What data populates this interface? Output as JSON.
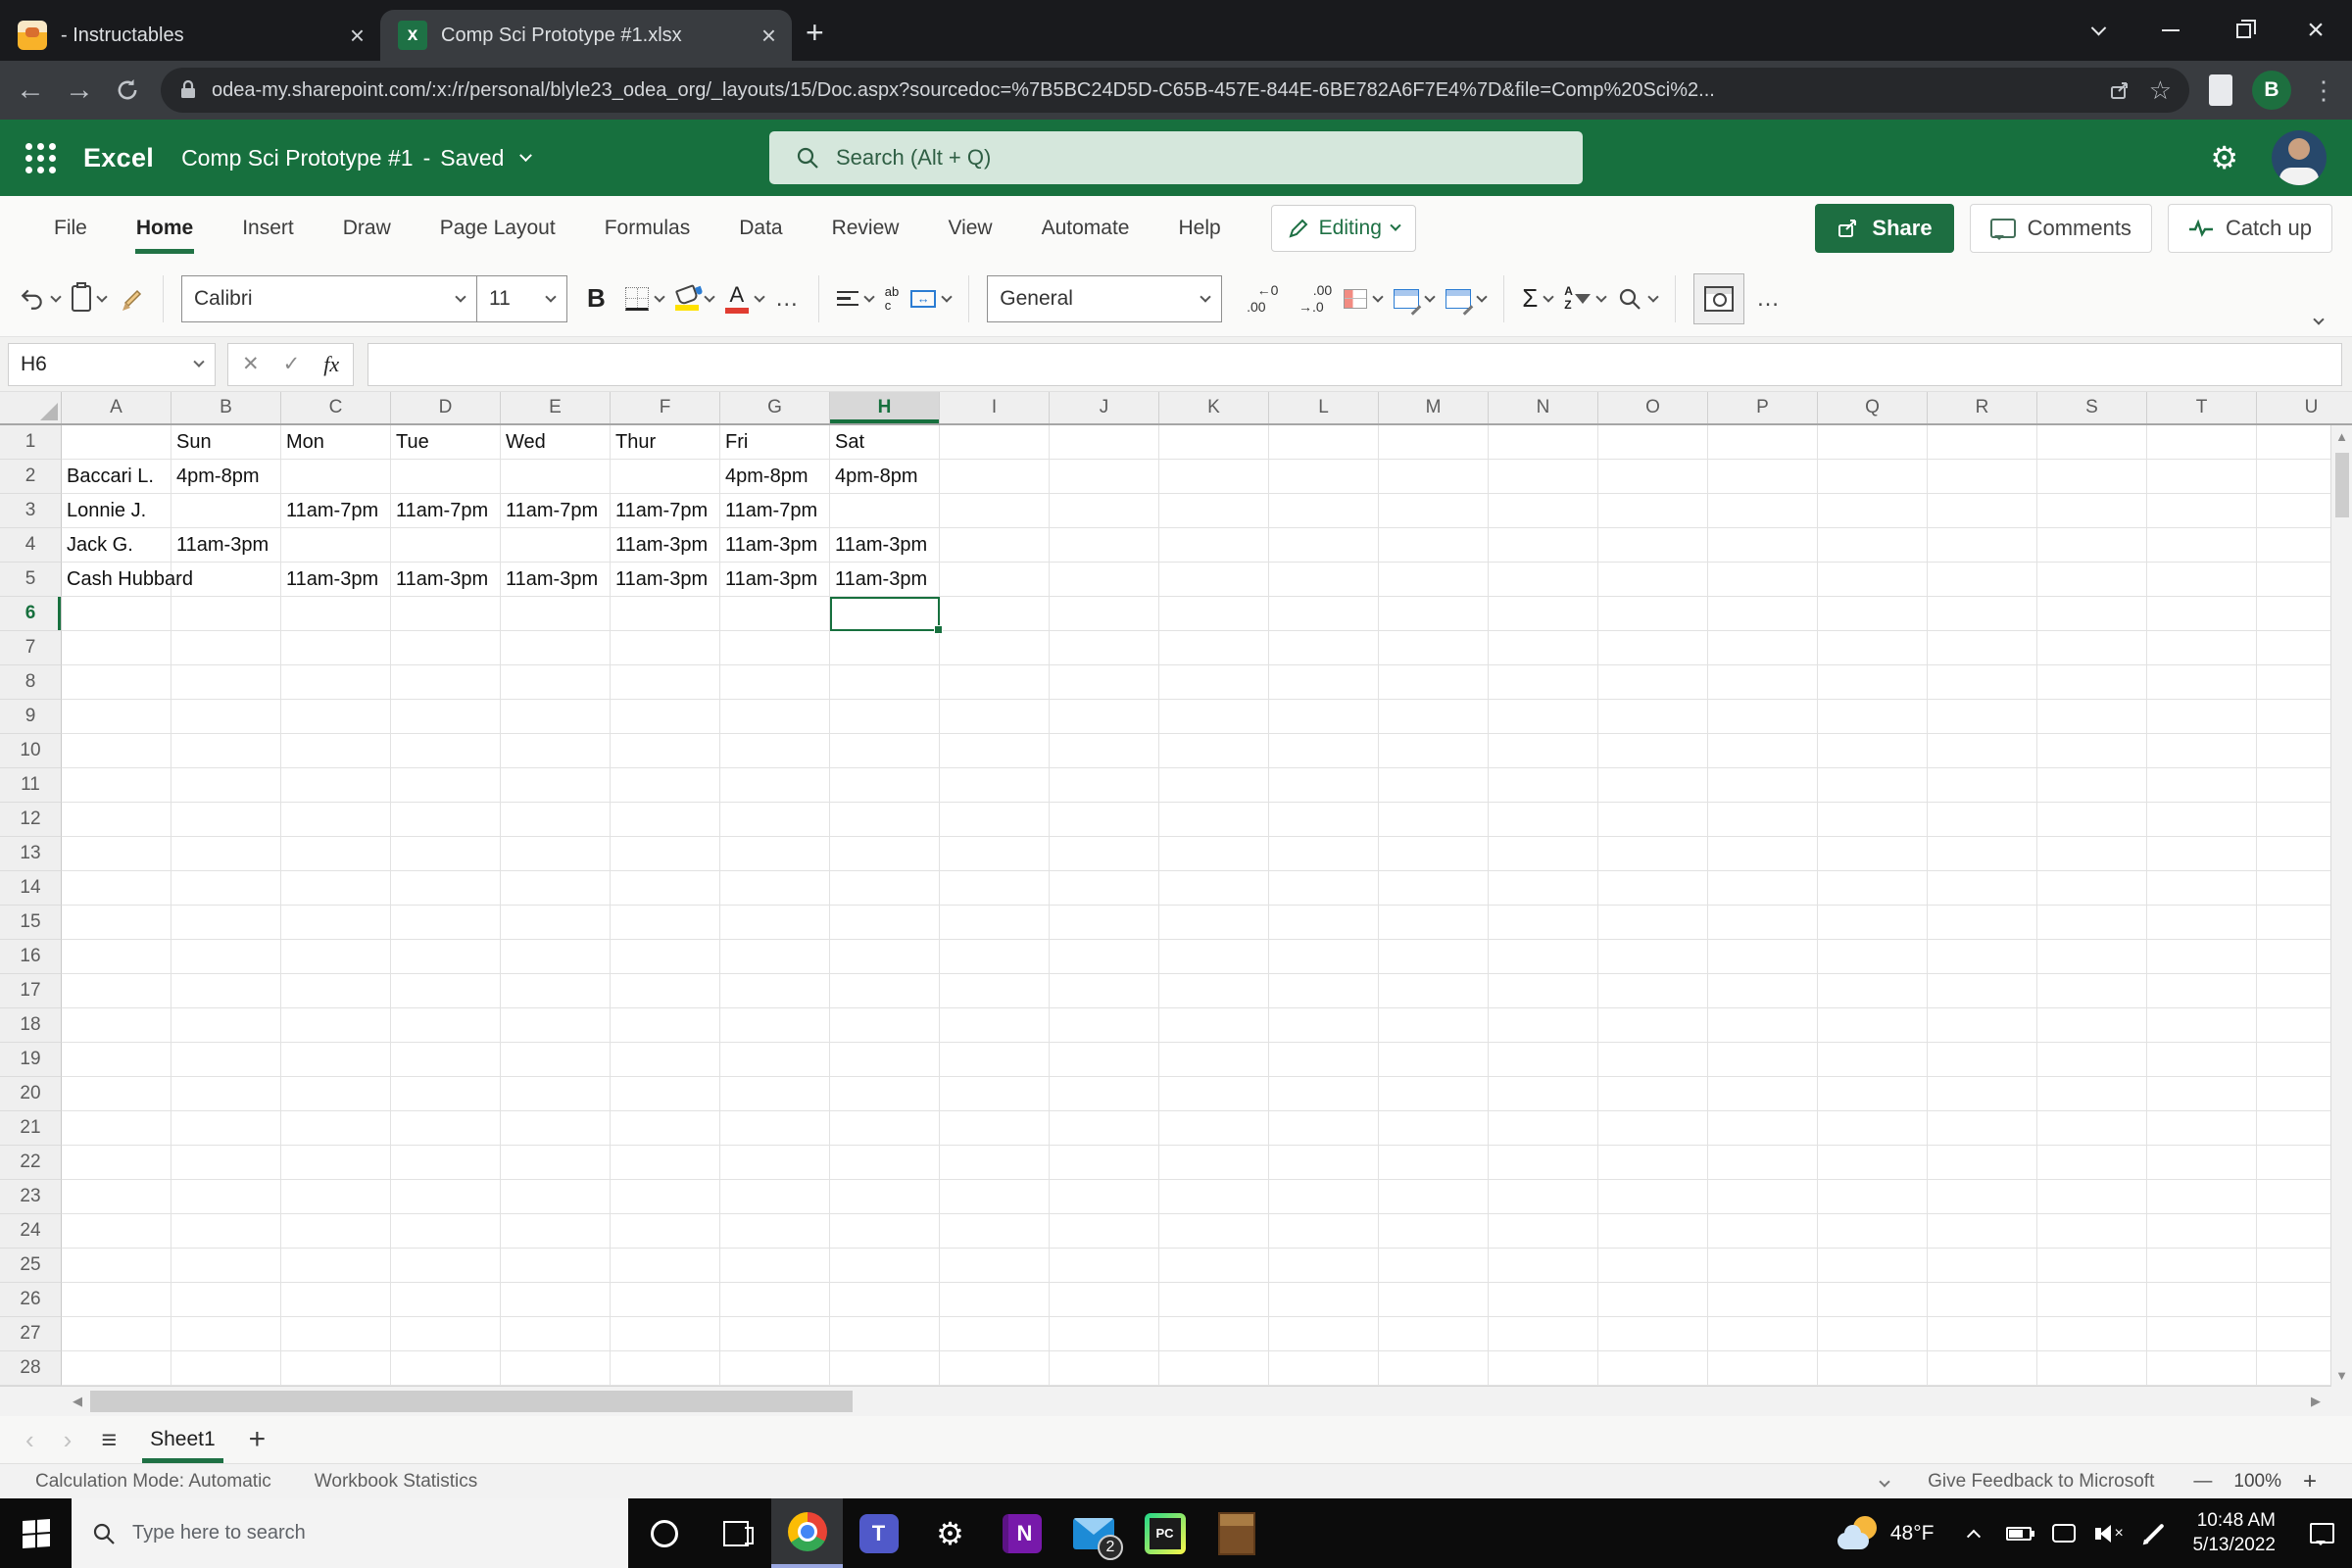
{
  "browser": {
    "tabs": [
      {
        "title": "- Instructables"
      },
      {
        "title": "Comp Sci Prototype #1.xlsx"
      }
    ],
    "url": "odea-my.sharepoint.com/:x:/r/personal/blyle23_odea_org/_layouts/15/Doc.aspx?sourcedoc=%7B5BC24D5D-C65B-457E-844E-6BE782A6F7E4%7D&file=Comp%20Sci%2...",
    "profile_initial": "B"
  },
  "header": {
    "app_name": "Excel",
    "doc_title": "Comp Sci Prototype #1",
    "separator": "-",
    "save_status": "Saved",
    "search_placeholder": "Search (Alt + Q)"
  },
  "ribbon": {
    "tabs": [
      "File",
      "Home",
      "Insert",
      "Draw",
      "Page Layout",
      "Formulas",
      "Data",
      "Review",
      "View",
      "Automate",
      "Help"
    ],
    "active_tab": "Home",
    "editing_label": "Editing",
    "share_label": "Share",
    "comments_label": "Comments",
    "catchup_label": "Catch up"
  },
  "toolbar": {
    "font_name": "Calibri",
    "font_size": "11",
    "number_format": "General",
    "glyphs": {
      "bold": "B",
      "font_color": "A",
      "wrap_top": "ab",
      "wrap_bottom": "c",
      "merge_arrows": "↔",
      "sum": "Σ",
      "sort_top": "A",
      "sort_bottom": "Z",
      "more": "…",
      "decrease_top": "←0",
      "decrease_bottom": ".00",
      "increase_top": ".00",
      "increase_bottom": "→.0"
    }
  },
  "formula_bar": {
    "name_box": "H6",
    "cancel_glyph": "✕",
    "enter_glyph": "✓",
    "fx_glyph": "fx",
    "formula": ""
  },
  "grid": {
    "columns": [
      "A",
      "B",
      "C",
      "D",
      "E",
      "F",
      "G",
      "H",
      "I",
      "J",
      "K",
      "L",
      "M",
      "N",
      "O",
      "P",
      "Q",
      "R",
      "S",
      "T",
      "U"
    ],
    "rows_visible": 28,
    "selected_cell": {
      "col": "H",
      "row": 6
    },
    "cell_data": {
      "1": {
        "B": "Sun",
        "C": "Mon",
        "D": "Tue",
        "E": "Wed",
        "F": "Thur",
        "G": "Fri",
        "H": "Sat"
      },
      "2": {
        "A": "Baccari L.",
        "B": "4pm-8pm",
        "G": "4pm-8pm",
        "H": "4pm-8pm"
      },
      "3": {
        "A": "Lonnie J.",
        "C": "11am-7pm",
        "D": "11am-7pm",
        "E": "11am-7pm",
        "F": "11am-7pm",
        "G": "11am-7pm"
      },
      "4": {
        "A": "Jack G.",
        "B": "11am-3pm",
        "F": "11am-3pm",
        "G": "11am-3pm",
        "H": "11am-3pm"
      },
      "5": {
        "A": "Cash Hubbard",
        "C": "11am-3pm",
        "D": "11am-3pm",
        "E": "11am-3pm",
        "F": "11am-3pm",
        "G": "11am-3pm",
        "H": "11am-3pm"
      }
    }
  },
  "sheet_bar": {
    "active_sheet": "Sheet1",
    "add_glyph": "+"
  },
  "status_bar": {
    "calc_mode": "Calculation Mode: Automatic",
    "workbook_stats": "Workbook Statistics",
    "feedback": "Give Feedback to Microsoft",
    "zoom_out_glyph": "—",
    "zoom_level": "100%",
    "zoom_in_glyph": "+"
  },
  "taskbar": {
    "search_placeholder": "Type here to search",
    "weather_temp": "48°F",
    "clock_time": "10:48 AM",
    "clock_date": "5/13/2022",
    "mail_badge": "2"
  },
  "colors": {
    "excel_green": "#17703e",
    "accent_green": "#217346",
    "share_button": "#1d6e41"
  }
}
